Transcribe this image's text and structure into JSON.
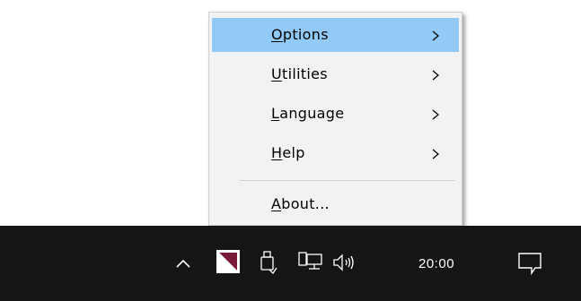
{
  "context_menu": {
    "items": [
      {
        "mnemonic": "O",
        "rest": "ptions",
        "has_submenu": true,
        "highlighted": true
      },
      {
        "mnemonic": "U",
        "rest": "tilities",
        "has_submenu": true,
        "highlighted": false
      },
      {
        "mnemonic": "L",
        "rest": "anguage",
        "has_submenu": true,
        "highlighted": false
      },
      {
        "mnemonic": "H",
        "rest": "elp",
        "has_submenu": true,
        "highlighted": false
      },
      {
        "mnemonic": "A",
        "rest": "bout...",
        "has_submenu": false,
        "highlighted": false
      }
    ],
    "submenu_icon": "chevron-right-icon",
    "highlight_color": "#91c9f7",
    "background_color": "#f2f2f2"
  },
  "taskbar": {
    "background_color": "#151515",
    "tray_icons": [
      "chevron-up-icon",
      "app-tray-icon",
      "usb-device-icon",
      "network-icon",
      "volume-icon"
    ],
    "app_icon_accent": "#7a1a3a",
    "clock": "20:00",
    "action_center_icon": "notification-icon"
  }
}
